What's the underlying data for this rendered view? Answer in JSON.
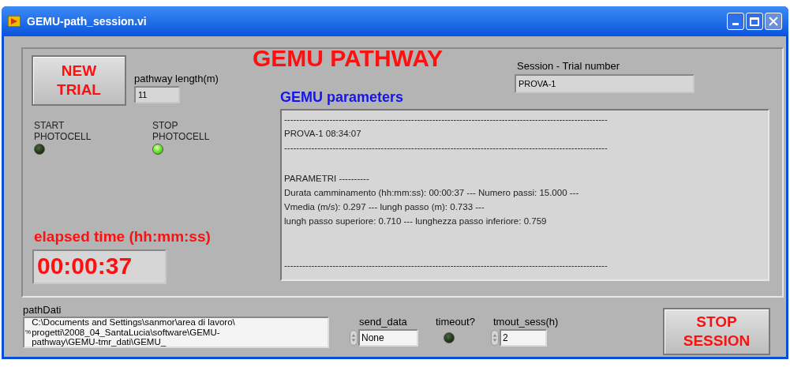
{
  "window": {
    "title": "GEMU-path_session.vi"
  },
  "title": "GEMU PATHWAY",
  "new_trial_button": {
    "lines": [
      "NEW",
      "TRIAL"
    ]
  },
  "pathway_length": {
    "label": "pathway length(m)",
    "value": "11"
  },
  "session": {
    "label": "Session - Trial number",
    "value": "PROVA-1"
  },
  "parameters": {
    "title": "GEMU parameters",
    "blocks": [
      [
        "-----------------------------------------------------------------------------------------------------------",
        "PROVA-1 08:34:07",
        "-----------------------------------------------------------------------------------------------------------"
      ],
      [
        "PARAMETRI ----------",
        "Durata camminamento (hh:mm:ss): 00:00:37 --- Numero passi: 15.000 ---",
        "Vmedia (m/s): 0.297 --- lungh passo (m): 0.733 ---",
        "lungh passo superiore: 0.710 --- lunghezza passo inferiore: 0.759"
      ],
      [
        "-----------------------------------------------------------------------------------------------------------"
      ]
    ]
  },
  "photocells": [
    {
      "lines": [
        "START",
        "PHOTOCELL"
      ],
      "on": false
    },
    {
      "lines": [
        "STOP",
        "PHOTOCELL"
      ],
      "on": true
    }
  ],
  "elapsed": {
    "label": "elapsed time (hh:mm:ss)",
    "value": "00:00:37"
  },
  "path_dati": {
    "label": "pathDati",
    "icon": "%",
    "lines": [
      "C:\\Documents and Settings\\sanmor\\area di lavoro\\",
      "progetti\\2008_04_SantaLucia\\software\\GEMU-",
      "pathway\\GEMU-tmr_dati\\GEMU_"
    ]
  },
  "send_data": {
    "label": "send_data",
    "value": "None"
  },
  "timeout": {
    "label": "timeout?",
    "on": false
  },
  "tmout_sess": {
    "label": "tmout_sess(h)",
    "value": "2"
  },
  "stop_button": {
    "lines": [
      "STOP",
      "SESSION"
    ]
  }
}
